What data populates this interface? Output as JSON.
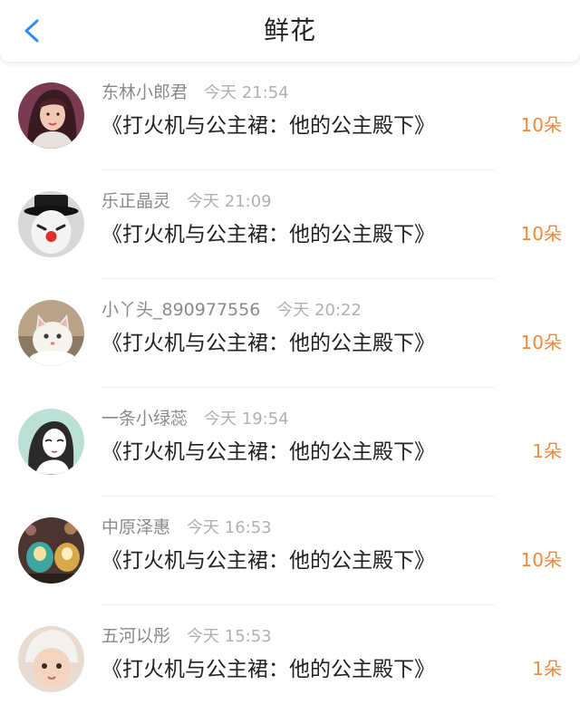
{
  "header": {
    "title": "鲜花",
    "back_icon": "chevron-left-icon",
    "accent": "#2f8ff0"
  },
  "colors": {
    "count": "#ef8a3c",
    "username": "#8a8a8a",
    "time": "#b0b0b0"
  },
  "records": [
    {
      "user": "东林小郎君",
      "time": "今天 21:54",
      "book": "《打火机与公主裙：他的公主殿下》",
      "count": "10朵",
      "avatar": "woman-portrait-avatar"
    },
    {
      "user": "乐正晶灵",
      "time": "今天 21:09",
      "book": "《打火机与公主裙：他的公主殿下》",
      "count": "10朵",
      "avatar": "clown-avatar"
    },
    {
      "user": "小丫头_890977556",
      "time": "今天 20:22",
      "book": "《打火机与公主裙：他的公主殿下》",
      "count": "10朵",
      "avatar": "cat-avatar"
    },
    {
      "user": "一条小绿蕊",
      "time": "今天 19:54",
      "book": "《打火机与公主裙：他的公主殿下》",
      "count": "1朵",
      "avatar": "drawn-girl-avatar"
    },
    {
      "user": "中原泽惠",
      "time": "今天 16:53",
      "book": "《打火机与公主裙：他的公主殿下》",
      "count": "10朵",
      "avatar": "candle-jars-avatar"
    },
    {
      "user": "五河以彤",
      "time": "今天 15:53",
      "book": "《打火机与公主裙：他的公主殿下》",
      "count": "1朵",
      "avatar": "baby-avatar"
    }
  ]
}
